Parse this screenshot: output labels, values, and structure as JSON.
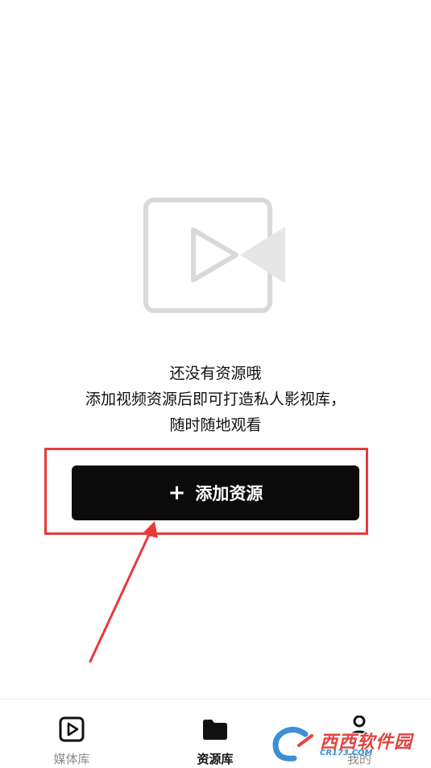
{
  "empty_state": {
    "line1": "还没有资源哦",
    "line2": "添加视频资源后即可打造私人影视库，",
    "line3": "随时随地观看",
    "icon": "video-camera-play-icon"
  },
  "add_button": {
    "plus": "+",
    "label": "添加资源"
  },
  "tabbar": {
    "tabs": [
      {
        "label": "媒体库",
        "icon": "play-square-icon",
        "active": false
      },
      {
        "label": "资源库",
        "icon": "folder-icon",
        "active": true
      },
      {
        "label": "我的",
        "icon": "person-icon",
        "active": false
      }
    ]
  },
  "watermark": {
    "main": "西西软件园",
    "sub": "CR173.COM"
  },
  "colors": {
    "annotation_red": "#e8393a",
    "button_bg": "#0b0b0b",
    "illustration_gray": "#d9d9d9",
    "tab_inactive": "#8a8a8a"
  }
}
